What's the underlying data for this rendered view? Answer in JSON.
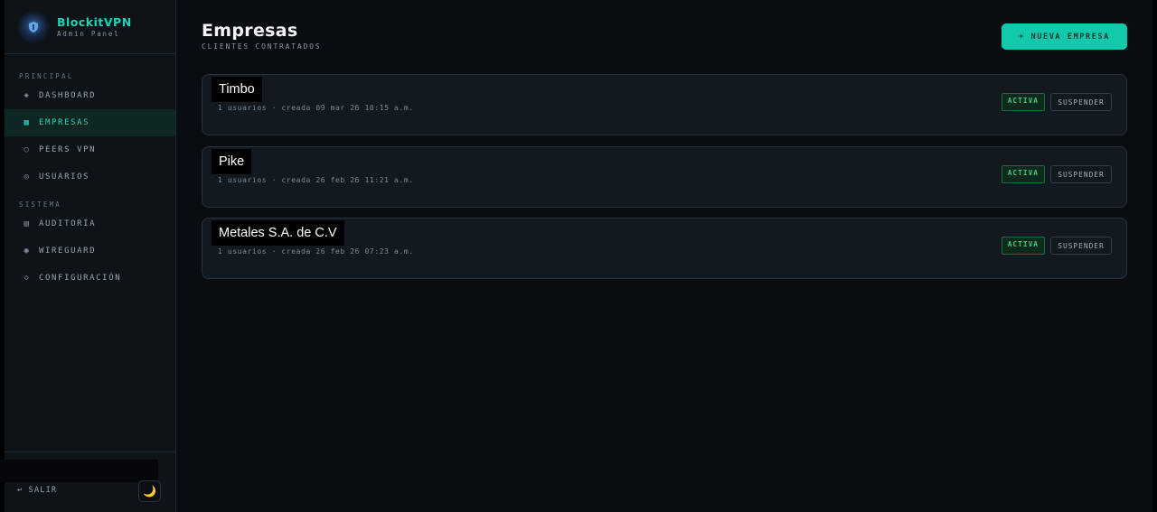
{
  "brand": {
    "name": "BlockitVPN",
    "subtitle": "Admin Panel",
    "logo_icon": "shield-logo-icon"
  },
  "sidebar": {
    "section_principal": "PRINCIPAL",
    "section_sistema": "SISTEMA",
    "items": [
      {
        "label": "DASHBOARD",
        "icon": "◈"
      },
      {
        "label": "EMPRESAS",
        "icon": "▦"
      },
      {
        "label": "PEERS VPN",
        "icon": "○"
      },
      {
        "label": "USUARIOS",
        "icon": "◎"
      },
      {
        "label": "AUDITORÍA",
        "icon": "▤"
      },
      {
        "label": "WIREGUARD",
        "icon": "◉"
      },
      {
        "label": "CONFIGURACIÓN",
        "icon": "◇"
      }
    ],
    "logout_label": "SALIR",
    "logout_icon": "↩",
    "theme_icon": "🌙"
  },
  "header": {
    "title": "Empresas",
    "subtitle": "CLIENTES CONTRATADOS",
    "new_button": "+ NUEVA EMPRESA"
  },
  "companies": [
    {
      "name": "Timbo",
      "meta": "1 usuarios · creada 09 mar 26 10:15 a.m.",
      "status": "ACTIVA",
      "action": "SUSPENDER"
    },
    {
      "name": "Pike",
      "meta": "1 usuarios · creada 26 feb 26 11:21 a.m.",
      "status": "ACTIVA",
      "action": "SUSPENDER"
    },
    {
      "name": "Metales S.A. de C.V",
      "meta": "1 usuarios · creada 26 feb 26 07:23 a.m.",
      "status": "ACTIVA",
      "action": "SUSPENDER"
    }
  ],
  "colors": {
    "accent": "#12c9ab",
    "active_badge": "#3cd07a",
    "background": "#0a0d12"
  }
}
